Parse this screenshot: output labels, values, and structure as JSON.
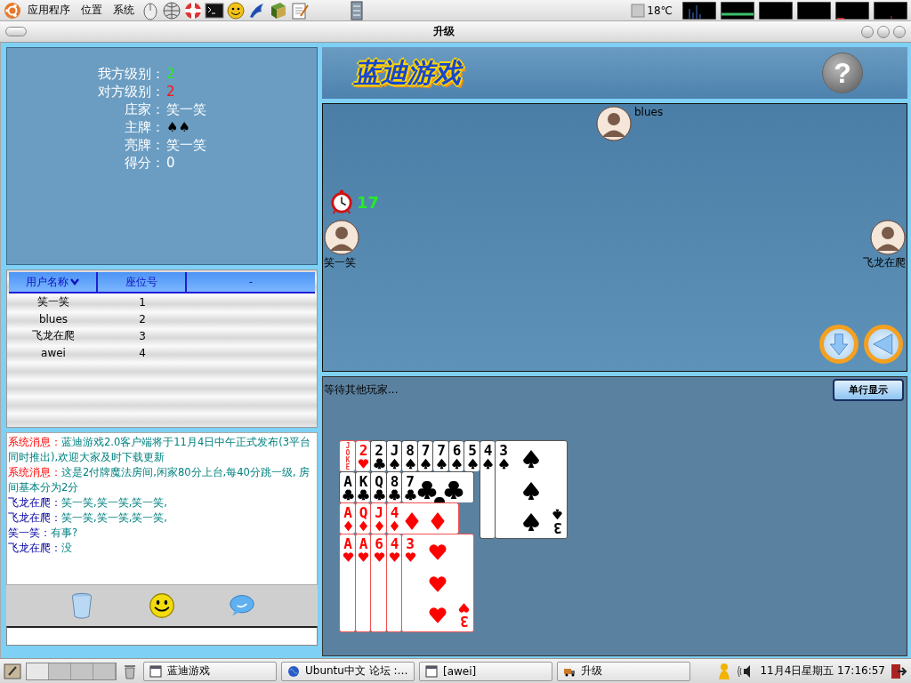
{
  "top_panel": {
    "menus": [
      "应用程序",
      "位置",
      "系统"
    ],
    "weather": "18℃"
  },
  "window": {
    "title": "升级"
  },
  "info": [
    {
      "label": "我方级别：",
      "value": "2",
      "color": "#22ee22"
    },
    {
      "label": "对方级别：",
      "value": "2",
      "color": "#ff1010"
    },
    {
      "label": "庄家：",
      "value": "笑一笑",
      "color": "#ffffff"
    },
    {
      "label": "主牌：",
      "value": "♠♠",
      "color": "#000000"
    },
    {
      "label": "亮牌：",
      "value": "笑一笑",
      "color": "#ffffff"
    },
    {
      "label": "得分：",
      "value": "0",
      "color": "#ffffff"
    }
  ],
  "users_table": {
    "columns": [
      {
        "label": "用户名称",
        "sorted": true
      },
      {
        "label": "座位号",
        "sorted": false
      },
      {
        "label": "-",
        "sorted": false
      }
    ],
    "rows": [
      {
        "name": "笑一笑",
        "seat": "1"
      },
      {
        "name": "blues",
        "seat": "2"
      },
      {
        "name": "飞龙在爬",
        "seat": "3"
      },
      {
        "name": "awei",
        "seat": "4"
      }
    ]
  },
  "chat": [
    {
      "kind": "system",
      "sender": "系统消息：",
      "text": "蓝迪游戏2.0客户端将于11月4日中午正式发布(3平台同时推出),欢迎大家及时下载更新"
    },
    {
      "kind": "system",
      "sender": "系统消息：",
      "text": "这是2付牌魔法房间,闲家80分上台,每40分跳一级, 房间基本分为2分"
    },
    {
      "kind": "user",
      "sender": "飞龙在爬：",
      "text": "笑一笑,笑一笑,笑一笑,"
    },
    {
      "kind": "user",
      "sender": "飞龙在爬：",
      "text": "笑一笑,笑一笑,笑一笑,"
    },
    {
      "kind": "user",
      "sender": "笑一笑：",
      "text": "有事?"
    },
    {
      "kind": "user",
      "sender": "飞龙在爬：",
      "text": "没"
    }
  ],
  "logo": "蓝迪游戏",
  "help": "?",
  "players": [
    {
      "name": "blues"
    },
    {
      "name": "笑一笑"
    },
    {
      "name": "飞龙在爬"
    }
  ],
  "timer": "17",
  "status": "等待其他玩家...",
  "display_button": "单行显示",
  "hand": [
    [
      {
        "rank": "JOKE",
        "kind": "joker"
      },
      {
        "rank": "2",
        "kind": "hearts"
      },
      {
        "rank": "2",
        "kind": "clubs"
      },
      {
        "rank": "J",
        "kind": "spades"
      },
      {
        "rank": "8",
        "kind": "spades"
      },
      {
        "rank": "7",
        "kind": "spades"
      },
      {
        "rank": "7",
        "kind": "spades"
      },
      {
        "rank": "6",
        "kind": "spades"
      },
      {
        "rank": "5",
        "kind": "spades"
      },
      {
        "rank": "4",
        "kind": "spades"
      },
      {
        "rank": "3",
        "kind": "spades",
        "corner": "3"
      }
    ],
    [
      {
        "rank": "A",
        "kind": "clubs"
      },
      {
        "rank": "K",
        "kind": "clubs"
      },
      {
        "rank": "Q",
        "kind": "clubs"
      },
      {
        "rank": "8",
        "kind": "clubs"
      },
      {
        "rank": "7",
        "kind": "clubs"
      }
    ],
    [
      {
        "rank": "A",
        "kind": "diamonds"
      },
      {
        "rank": "Q",
        "kind": "diamonds"
      },
      {
        "rank": "J",
        "kind": "diamonds"
      },
      {
        "rank": "4",
        "kind": "diamonds"
      }
    ],
    [
      {
        "rank": "A",
        "kind": "hearts"
      },
      {
        "rank": "A",
        "kind": "hearts"
      },
      {
        "rank": "6",
        "kind": "hearts"
      },
      {
        "rank": "4",
        "kind": "hearts"
      },
      {
        "rank": "3",
        "kind": "hearts",
        "corner": "3"
      }
    ]
  ],
  "taskbar": {
    "workspaces": [
      {
        "selected": true
      },
      {
        "selected": false
      },
      {
        "selected": false
      },
      {
        "selected": false
      }
    ],
    "tasks": [
      {
        "label": "蓝迪游戏"
      },
      {
        "label": "Ubuntu中文 论坛 :…"
      },
      {
        "label": "[awei]"
      },
      {
        "label": "升级"
      }
    ],
    "clock": "11月4日星期五 17:16:57"
  }
}
